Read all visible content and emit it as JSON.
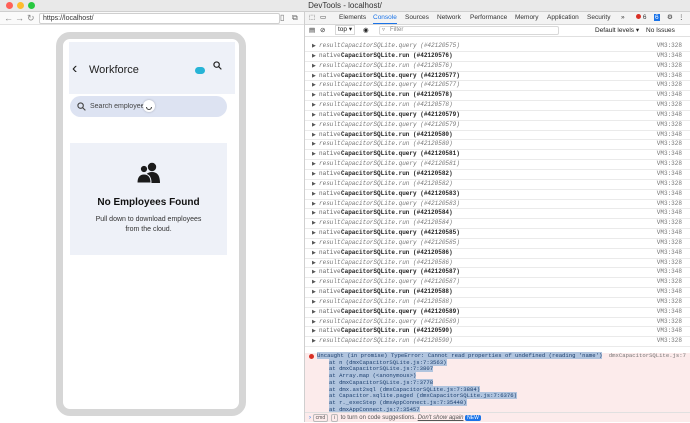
{
  "window": {
    "title": "DevTools - localhost/"
  },
  "browser": {
    "url": "https://localhost/"
  },
  "app": {
    "title": "Workforce",
    "search_placeholder": "Search employees",
    "empty_title": "No Employees Found",
    "empty_subtitle": "Pull down to download employees from the cloud."
  },
  "devtools": {
    "tabs": [
      "Elements",
      "Console",
      "Sources",
      "Network",
      "Performance",
      "Memory",
      "Application",
      "Security"
    ],
    "more": "»",
    "error_count": "6",
    "chat_count": "6",
    "context": "top",
    "filter_placeholder": "Filter",
    "levels": "Default levels",
    "issues": "No Issues",
    "logs": [
      {
        "kind": "result",
        "text": "CapacitorSQLite.query (#42120575)",
        "src": "VM3:328"
      },
      {
        "kind": "native",
        "text": "CapacitorSQLite.run (#42120576)",
        "src": "VM3:348"
      },
      {
        "kind": "result",
        "text": "CapacitorSQLite.run (#42120576)",
        "src": "VM3:328"
      },
      {
        "kind": "native",
        "text": "CapacitorSQLite.query (#42120577)",
        "src": "VM3:348"
      },
      {
        "kind": "result",
        "text": "CapacitorSQLite.query (#42120577)",
        "src": "VM3:328"
      },
      {
        "kind": "native",
        "text": "CapacitorSQLite.run (#42120578)",
        "src": "VM3:348"
      },
      {
        "kind": "result",
        "text": "CapacitorSQLite.run (#42120578)",
        "src": "VM3:328"
      },
      {
        "kind": "native",
        "text": "CapacitorSQLite.query (#42120579)",
        "src": "VM3:348"
      },
      {
        "kind": "result",
        "text": "CapacitorSQLite.query (#42120579)",
        "src": "VM3:328"
      },
      {
        "kind": "native",
        "text": "CapacitorSQLite.run (#42120580)",
        "src": "VM3:348"
      },
      {
        "kind": "result",
        "text": "CapacitorSQLite.run (#42120580)",
        "src": "VM3:328"
      },
      {
        "kind": "native",
        "text": "CapacitorSQLite.query (#42120581)",
        "src": "VM3:348"
      },
      {
        "kind": "result",
        "text": "CapacitorSQLite.query (#42120581)",
        "src": "VM3:328"
      },
      {
        "kind": "native",
        "text": "CapacitorSQLite.run (#42120582)",
        "src": "VM3:348"
      },
      {
        "kind": "result",
        "text": "CapacitorSQLite.run (#42120582)",
        "src": "VM3:328"
      },
      {
        "kind": "native",
        "text": "CapacitorSQLite.query (#42120583)",
        "src": "VM3:348"
      },
      {
        "kind": "result",
        "text": "CapacitorSQLite.query (#42120583)",
        "src": "VM3:328"
      },
      {
        "kind": "native",
        "text": "CapacitorSQLite.run (#42120584)",
        "src": "VM3:348"
      },
      {
        "kind": "result",
        "text": "CapacitorSQLite.run (#42120584)",
        "src": "VM3:328"
      },
      {
        "kind": "native",
        "text": "CapacitorSQLite.query (#42120585)",
        "src": "VM3:348"
      },
      {
        "kind": "result",
        "text": "CapacitorSQLite.query (#42120585)",
        "src": "VM3:328"
      },
      {
        "kind": "native",
        "text": "CapacitorSQLite.run (#42120586)",
        "src": "VM3:348"
      },
      {
        "kind": "result",
        "text": "CapacitorSQLite.run (#42120586)",
        "src": "VM3:328"
      },
      {
        "kind": "native",
        "text": "CapacitorSQLite.query (#42120587)",
        "src": "VM3:348"
      },
      {
        "kind": "result",
        "text": "CapacitorSQLite.query (#42120587)",
        "src": "VM3:328"
      },
      {
        "kind": "native",
        "text": "CapacitorSQLite.run (#42120588)",
        "src": "VM3:348"
      },
      {
        "kind": "result",
        "text": "CapacitorSQLite.run (#42120588)",
        "src": "VM3:328"
      },
      {
        "kind": "native",
        "text": "CapacitorSQLite.query (#42120589)",
        "src": "VM3:348"
      },
      {
        "kind": "result",
        "text": "CapacitorSQLite.query (#42120589)",
        "src": "VM3:328"
      },
      {
        "kind": "native",
        "text": "CapacitorSQLite.run (#42120590)",
        "src": "VM3:348"
      },
      {
        "kind": "result",
        "text": "CapacitorSQLite.run (#42120590)",
        "src": "VM3:328"
      }
    ],
    "error": {
      "message": "Uncaught (in promise) TypeError: Cannot read properties of undefined (reading 'name')",
      "source": "dmxCapacitorSQLite.js:7",
      "stack": [
        "at n (dmxCapacitorSQLite.js:7:3563)",
        "at dmxCapacitorSQLite.js:7:3807",
        "at Array.map (<anonymous>)",
        "at dmxCapacitorSQLite.js:7:3778",
        "at dmx.ast2sql (dmxCapacitorSQLite.js:7:3884)",
        "at Capacitor.sqlite.paged (dmxCapacitorSQLite.js:7:6376)",
        "at r._execStep (dmxAppConnect.js:7:35440)",
        "at dmxAppConnect.js:7:35457"
      ]
    },
    "prompt": {
      "key1": "cmd",
      "key2": "i",
      "text": "to turn on code suggestions.",
      "dismiss": "Don't show again",
      "badge": "NEW"
    }
  }
}
